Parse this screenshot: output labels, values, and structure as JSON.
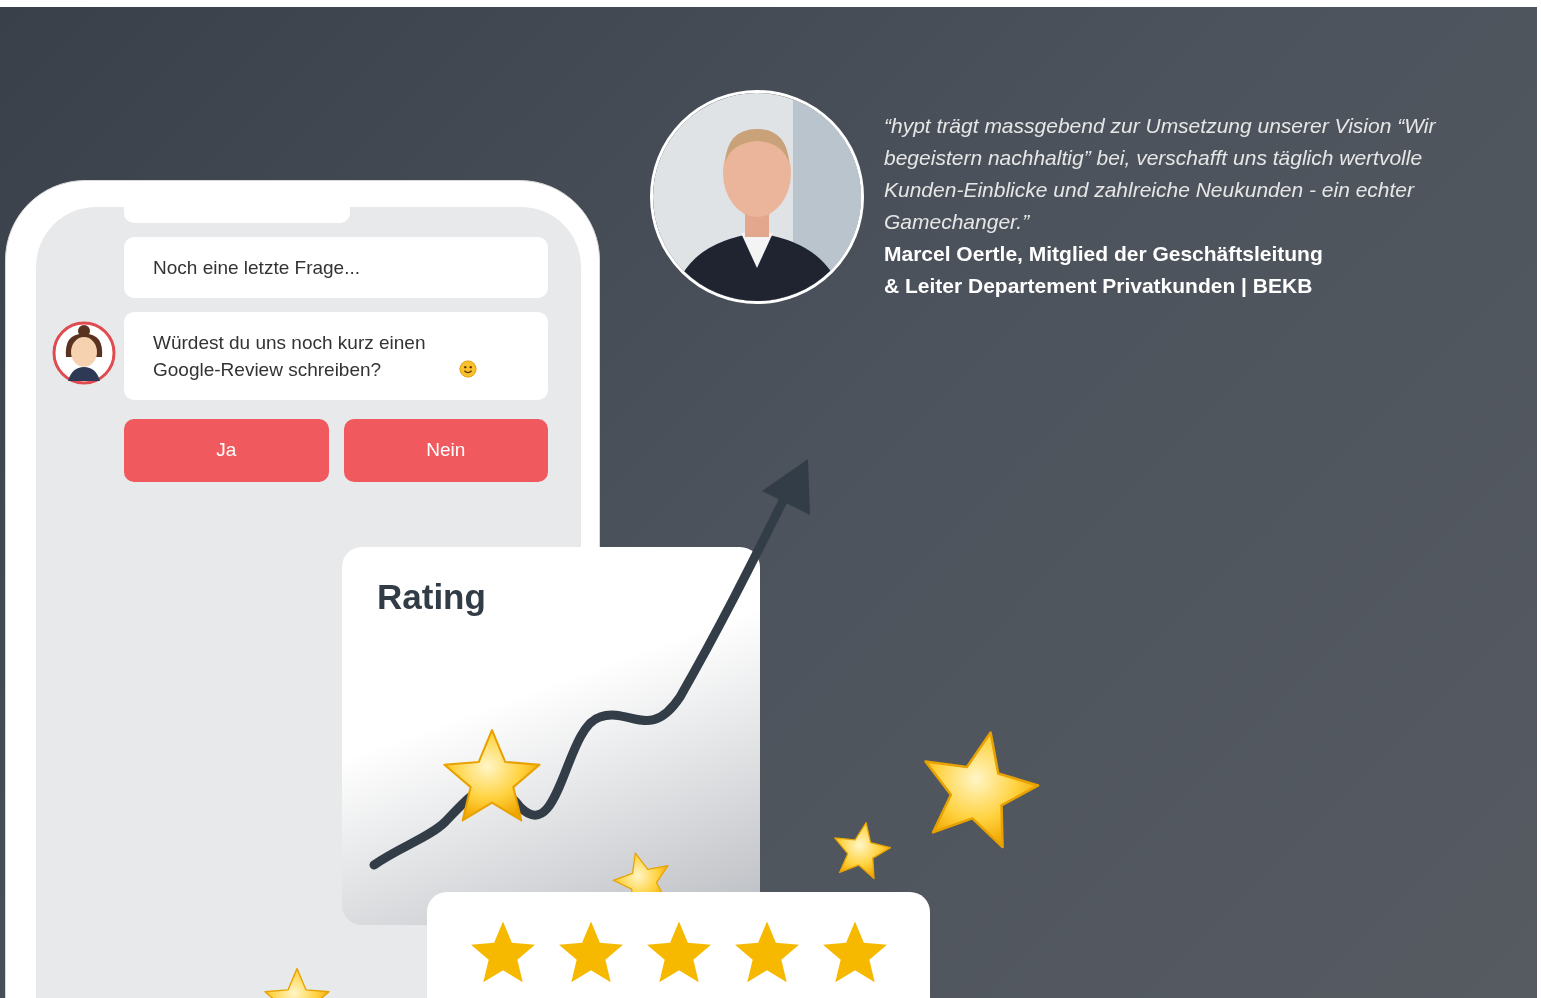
{
  "chat": {
    "messages": [
      {
        "text": "Noch eine letzte Frage..."
      },
      {
        "text": "Würdest du uns noch kurz einen Google-Review schreiben?"
      }
    ],
    "buttons": [
      "Ja",
      "Nein"
    ]
  },
  "rating": {
    "title": "Rating",
    "stars": 5
  },
  "testimonial": {
    "quote": "“hypt trägt massgebend zur Umsetzung unserer Vision “Wir begeistern nachhaltig” bei, verschafft uns täglich wertvolle Kunden-Einblicke und zahlreiche Neukunden - ein echter Gamechanger.”",
    "author": [
      "Marcel Oertle, Mitglied der Geschäftsleitung",
      "& Leiter Departement Privatkunden | BEKB"
    ]
  }
}
